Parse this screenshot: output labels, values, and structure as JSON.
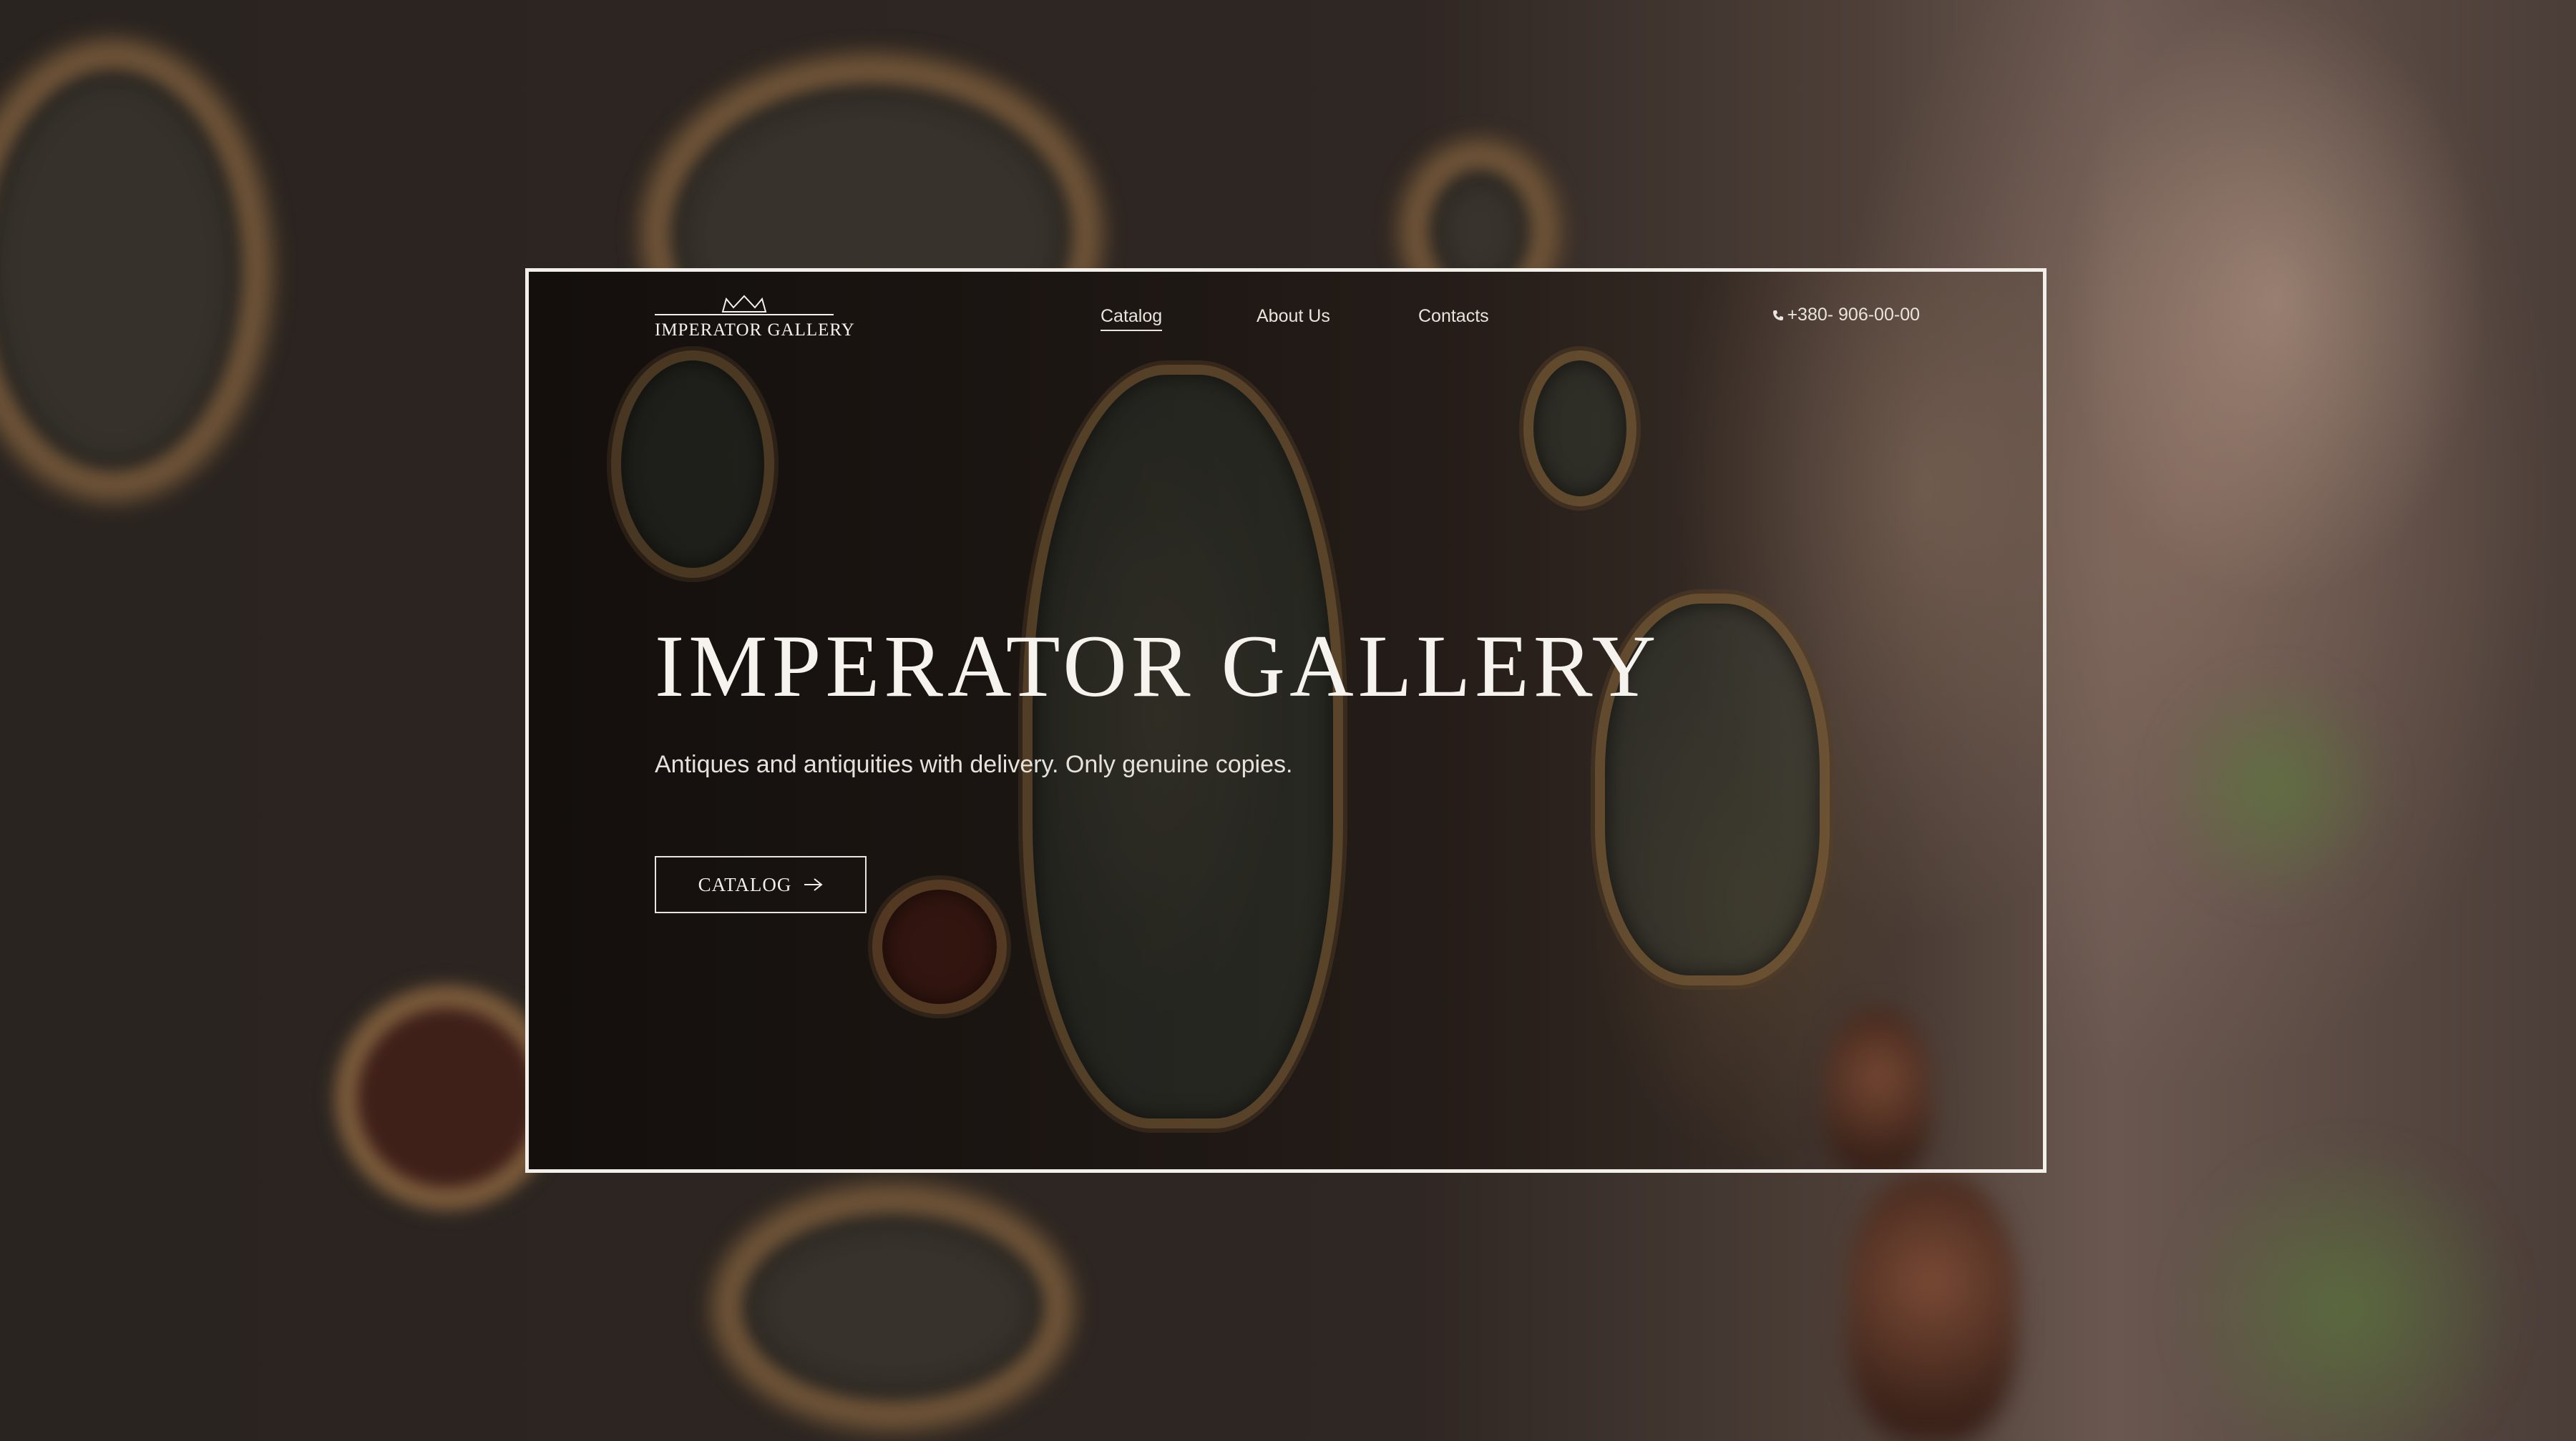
{
  "brand": {
    "logo_icon": "crown-icon",
    "logo_text": "IMPERATOR GALLERY"
  },
  "nav": {
    "items": [
      {
        "label": "Catalog",
        "active": true
      },
      {
        "label": "About Us",
        "active": false
      },
      {
        "label": "Contacts",
        "active": false
      }
    ]
  },
  "contact": {
    "phone_icon": "phone-icon",
    "phone": "+380- 906-00-00"
  },
  "hero": {
    "title": "IMPERATOR GALLERY",
    "subtitle": "Antiques and antiquities with delivery. Only genuine copies.",
    "cta_label": "CATALOG",
    "cta_icon": "arrow-right-icon"
  },
  "colors": {
    "text": "#f4f1ec",
    "frame_border": "#f2efea",
    "background": "#2a2420"
  }
}
